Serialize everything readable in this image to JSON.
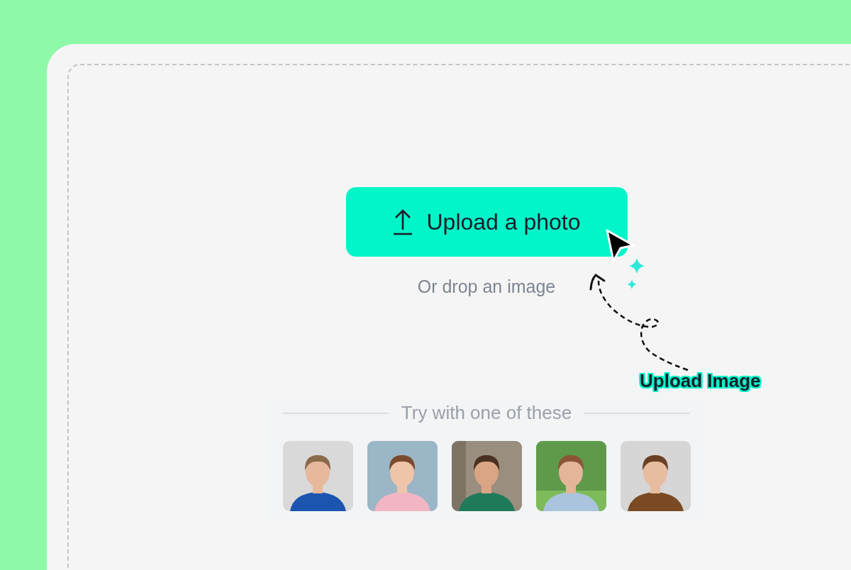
{
  "upload_button": {
    "label": "Upload a photo"
  },
  "drop_hint": "Or drop an image",
  "annotation": {
    "label": "Upload Image"
  },
  "samples": {
    "heading": "Try with one of these"
  }
}
